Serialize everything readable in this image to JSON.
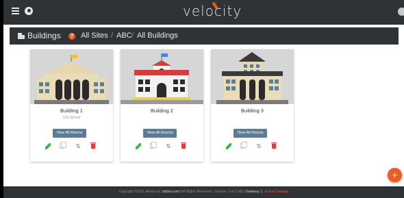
{
  "header": {
    "brand": "velocity",
    "colors": {
      "bar": "#2f3336",
      "accent": "#f25b1d"
    },
    "icons": [
      "menu-icon",
      "logo-icon",
      "user-avatar-icon"
    ]
  },
  "breadcrumb": {
    "title": "Buildings",
    "items": [
      "All Sites",
      "ABC",
      "All Buildings"
    ],
    "separator": "/"
  },
  "cards": [
    {
      "name": "Building 1",
      "street": "123 Street",
      "button": "View All Rooms"
    },
    {
      "name": "Building 2",
      "street": "",
      "button": "View All Rooms"
    },
    {
      "name": "Building 3",
      "street": "",
      "button": "View All Rooms"
    }
  ],
  "actions": [
    "edit-icon",
    "copy-icon",
    "move-icon",
    "delete-icon"
  ],
  "fab": {
    "label": "+"
  },
  "footer": {
    "prefix": "Copyright ©2021 Atlona Inc (",
    "link": "atlona.com",
    "middle": ") All Rights Reserved. | Version: 2.4.2 (v8) | ",
    "gateway": "Gateway 1:",
    "status": "Active Gateway"
  }
}
